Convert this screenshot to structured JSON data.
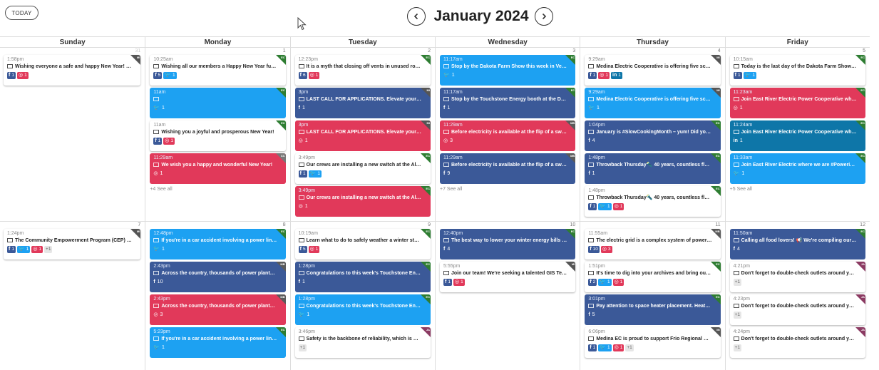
{
  "header": {
    "today_label": "TODAY",
    "month_title": "January 2024"
  },
  "colors": {
    "facebook": "#3b5998",
    "twitter": "#1da1f2",
    "instagram": "#e1395a",
    "linkedin": "#0e76a8",
    "tag_ec": "#2e7d32",
    "tag_mi": "#555555",
    "tag_cc": "#777777",
    "tag_mb": "#5a5a5a",
    "tag_ja": "#8b3a62"
  },
  "day_headers": [
    "Sunday",
    "Monday",
    "Tuesday",
    "Wednesday",
    "Thursday",
    "Friday"
  ],
  "weeks": [
    {
      "days": [
        {
          "num": "31",
          "muted": true,
          "posts": [
            {
              "time": "1:58pm",
              "text": "Wishing everyone a safe and happy New Year! We ...",
              "style": "white",
              "tag": "MI",
              "badges": [
                {
                  "kind": "fb",
                  "count": "1"
                },
                {
                  "kind": "ig",
                  "count": "1"
                }
              ]
            }
          ],
          "see_all": ""
        },
        {
          "num": "1",
          "posts": [
            {
              "time": "10:25am",
              "text": "Wishing all our members a Happy New Year full of l...",
              "style": "white",
              "tag": "EC",
              "badges": [
                {
                  "kind": "fb",
                  "count": "5"
                },
                {
                  "kind": "tw",
                  "count": "1"
                }
              ]
            },
            {
              "time": "11am",
              "text": "",
              "style": "blue",
              "tag": "EC",
              "plain": "tw",
              "plain_count": "1"
            },
            {
              "time": "11am",
              "text": "Wishing you a joyful and prosperous New Year!",
              "style": "white",
              "tag": "EC",
              "badges": [
                {
                  "kind": "fb",
                  "count": "1"
                },
                {
                  "kind": "ig",
                  "count": "1"
                }
              ]
            },
            {
              "time": "11:29am",
              "text": "We wish you a happy and wonderful New Year!",
              "style": "red",
              "tag": "CC",
              "plain": "ig",
              "plain_count": "1"
            }
          ],
          "see_all": "+4 See all"
        },
        {
          "num": "2",
          "posts": [
            {
              "time": "12:23pm",
              "text": "It is a myth that closing off vents in unused rooms wi...",
              "style": "white",
              "tag": "EC",
              "badges": [
                {
                  "kind": "fb",
                  "count": "6"
                },
                {
                  "kind": "ig",
                  "count": "1"
                }
              ]
            },
            {
              "time": "3pm",
              "text": "LAST CALL FOR APPLICATIONS. Elevate your sum...",
              "style": "navy",
              "tag": "MI",
              "plain": "fb",
              "plain_count": "1"
            },
            {
              "time": "3pm",
              "text": "LAST CALL FOR APPLICATIONS. Elevate your sum...",
              "style": "red",
              "tag": "MI",
              "plain": "ig",
              "plain_count": "1"
            },
            {
              "time": "3:49pm",
              "text": "Our crews are installing a new switch at the Alceste...",
              "style": "white",
              "tag": "EC",
              "badges": [
                {
                  "kind": "fb",
                  "count": "1"
                },
                {
                  "kind": "tw",
                  "count": "1"
                }
              ]
            },
            {
              "time": "3:49pm",
              "text": "Our crews are installing a new switch at the Alceste...",
              "style": "red",
              "tag": "EC",
              "plain": "ig",
              "plain_count": "1"
            }
          ],
          "see_all": ""
        },
        {
          "num": "3",
          "posts": [
            {
              "time": "11:17am",
              "text": "Stop by the Dakota Farm Show this week in Vermilli...",
              "style": "blue",
              "tag": "EC",
              "plain": "tw",
              "plain_count": "1"
            },
            {
              "time": "11:17am",
              "text": "Stop by the Touchstone Energy booth at the Dakota ...",
              "style": "navy",
              "tag": "EC",
              "plain": "fb",
              "plain_count": "1"
            },
            {
              "time": "11:29am",
              "text": "Before electricity is available at the flip of a switch, i...",
              "style": "red",
              "tag": "MB",
              "plain": "ig",
              "plain_count": "3"
            },
            {
              "time": "11:29am",
              "text": "Before electricity is available at the flip of a switch, i...",
              "style": "navy",
              "tag": "MB",
              "plain": "fb",
              "plain_count": "9"
            }
          ],
          "see_all": "+7 See all"
        },
        {
          "num": "4",
          "posts": [
            {
              "time": "9:29am",
              "text": "Medina Electric Cooperative is offering five scholars...",
              "style": "white",
              "tag": "MI",
              "badges": [
                {
                  "kind": "fb",
                  "count": "1"
                },
                {
                  "kind": "ig",
                  "count": "1"
                },
                {
                  "kind": "li",
                  "count": "1"
                }
              ]
            },
            {
              "time": "9:29am",
              "text": "Medina Electric Cooperative is offering five scholarship...",
              "style": "blue",
              "tag": "MI",
              "plain": "tw",
              "plain_count": "1"
            },
            {
              "time": "1:04pm",
              "text": "January is #SlowCookingMonth – yum! Did you kno...",
              "style": "navy",
              "tag": "EC",
              "plain": "fb",
              "plain_count": "4"
            },
            {
              "time": "1:48pm",
              "text": "Throwback Thursday🔦 40 years, countless flavors, ...",
              "style": "navy",
              "tag": "EC",
              "plain": "fb",
              "plain_count": "1"
            },
            {
              "time": "1:48pm",
              "text": "Throwback Thursday🔦 40 years, countless flavors, ...",
              "style": "white",
              "tag": "EC",
              "badges": [
                {
                  "kind": "fb",
                  "count": "1"
                },
                {
                  "kind": "tw",
                  "count": "1"
                },
                {
                  "kind": "ig",
                  "count": "1"
                }
              ]
            }
          ],
          "see_all": ""
        },
        {
          "num": "5",
          "posts": [
            {
              "time": "10:15am",
              "text": "Today is the last day of the Dakota Farm Show in Ve...",
              "style": "white",
              "tag": "EC",
              "badges": [
                {
                  "kind": "fb",
                  "count": "1"
                },
                {
                  "kind": "tw",
                  "count": "1"
                }
              ]
            },
            {
              "time": "11:23am",
              "text": "Join East River Electric Power Cooperative where w...",
              "style": "red",
              "tag": "EC",
              "plain": "ig",
              "plain_count": "1"
            },
            {
              "time": "11:24am",
              "text": "Join East River Electric Power Cooperative where we...",
              "style": "teal",
              "tag": "EC",
              "plain": "li",
              "plain_count": "1"
            },
            {
              "time": "11:33am",
              "text": "Join East River Electric where we are #PoweringCar...",
              "style": "blue",
              "tag": "EC",
              "plain": "tw",
              "plain_count": "1"
            }
          ],
          "see_all": "+5 See all"
        }
      ]
    },
    {
      "days": [
        {
          "num": "7",
          "posts": [
            {
              "time": "1:24pm",
              "text": "The Community Empowerment Program (CEP) provi...",
              "style": "white",
              "tag": "MI",
              "badges": [
                {
                  "kind": "fb",
                  "count": "1"
                },
                {
                  "kind": "tw",
                  "count": "1"
                },
                {
                  "kind": "ig",
                  "count": "1"
                },
                {
                  "kind": "other",
                  "count": "+1"
                }
              ]
            }
          ],
          "see_all": ""
        },
        {
          "num": "8",
          "posts": [
            {
              "time": "12:48pm",
              "text": "If you're in a car accident involving a power line, sta...",
              "style": "blue",
              "tag": "EC",
              "plain": "tw",
              "plain_count": "1"
            },
            {
              "time": "2:43pm",
              "text": "Across the country, thousands of power plants gene...",
              "style": "navy",
              "tag": "MB",
              "plain": "fb",
              "plain_count": "10"
            },
            {
              "time": "2:43pm",
              "text": "Across the country, thousands of power plants gene...",
              "style": "red",
              "tag": "MB",
              "plain": "ig",
              "plain_count": "3"
            },
            {
              "time": "5:23pm",
              "text": "If you're in a car accident involving a power line, sta...",
              "style": "blue",
              "tag": "EC",
              "plain": "tw",
              "plain_count": "1"
            }
          ],
          "see_all": ""
        },
        {
          "num": "9",
          "posts": [
            {
              "time": "10:19am",
              "text": "Learn what to do to safely weather a winter storm: ...",
              "style": "white",
              "tag": "EC",
              "badges": [
                {
                  "kind": "fb",
                  "count": "5"
                },
                {
                  "kind": "ig",
                  "count": "1"
                }
              ]
            },
            {
              "time": "1:28pm",
              "text": "Congratulations to this week's Touchstone Energy S...",
              "style": "navy",
              "tag": "EC",
              "plain": "fb",
              "plain_count": "1"
            },
            {
              "time": "1:28pm",
              "text": "Congratulations to this week's Touchstone Energy S...",
              "style": "blue",
              "tag": "EC",
              "plain": "tw",
              "plain_count": "1"
            },
            {
              "time": "3:46pm",
              "text": "Safety is the backbone of reliability, which is why sa...",
              "style": "white",
              "tag": "JA",
              "badges": [
                {
                  "kind": "other",
                  "count": "+1"
                }
              ]
            }
          ],
          "see_all": ""
        },
        {
          "num": "10",
          "posts": [
            {
              "time": "12:40pm",
              "text": "The best way to lower your winter energy bills is to l...",
              "style": "navy",
              "tag": "EC",
              "plain": "fb",
              "plain_count": "4"
            },
            {
              "time": "5:55pm",
              "text": "Join our team! We're seeking a talented GIS Technic...",
              "style": "white",
              "tag": "MI",
              "badges": [
                {
                  "kind": "fb",
                  "count": "1"
                },
                {
                  "kind": "ig",
                  "count": "1"
                }
              ]
            }
          ],
          "see_all": ""
        },
        {
          "num": "11",
          "posts": [
            {
              "time": "11:55am",
              "text": "The electric grid is a complex system of power plant...",
              "style": "white",
              "tag": "MB",
              "badges": [
                {
                  "kind": "fb",
                  "count": "10"
                },
                {
                  "kind": "ig",
                  "count": "3"
                }
              ]
            },
            {
              "time": "1:51pm",
              "text": "It's time to dig into your archives and bring out your ...",
              "style": "white",
              "tag": "EC",
              "badges": [
                {
                  "kind": "fb",
                  "count": "2"
                },
                {
                  "kind": "tw",
                  "count": "1"
                },
                {
                  "kind": "ig",
                  "count": "1"
                }
              ]
            },
            {
              "time": "3:01pm",
              "text": "Pay attention to space heater placement. Heaters s...",
              "style": "navy",
              "tag": "EC",
              "plain": "fb",
              "plain_count": "5"
            },
            {
              "time": "6:06pm",
              "text": "Medina EC is proud to support Frio Regional Hospit...",
              "style": "white",
              "tag": "MI",
              "badges": [
                {
                  "kind": "fb",
                  "count": "1"
                },
                {
                  "kind": "tw",
                  "count": "1"
                },
                {
                  "kind": "ig",
                  "count": "1"
                },
                {
                  "kind": "other",
                  "count": "+1"
                }
              ]
            }
          ],
          "see_all": ""
        },
        {
          "num": "12",
          "posts": [
            {
              "time": "11:50am",
              "text": "Calling all food lovers! 📢 We're compiling our 40th ...",
              "style": "navy",
              "tag": "EC",
              "plain": "fb",
              "plain_count": "4"
            },
            {
              "time": "4:21pm",
              "text": "Don't forget to double-check outlets around your h...",
              "style": "white",
              "tag": "JA",
              "badges": [
                {
                  "kind": "other",
                  "count": "+1"
                }
              ]
            },
            {
              "time": "4:23pm",
              "text": "Don't forget to double-check outlets around your h...",
              "style": "white",
              "tag": "JA",
              "badges": [
                {
                  "kind": "other",
                  "count": "+1"
                }
              ]
            },
            {
              "time": "4:24pm",
              "text": "Don't forget to double-check outlets around your h...",
              "style": "white",
              "tag": "JA",
              "badges": [
                {
                  "kind": "other",
                  "count": "+1"
                }
              ]
            }
          ],
          "see_all": ""
        }
      ]
    }
  ]
}
